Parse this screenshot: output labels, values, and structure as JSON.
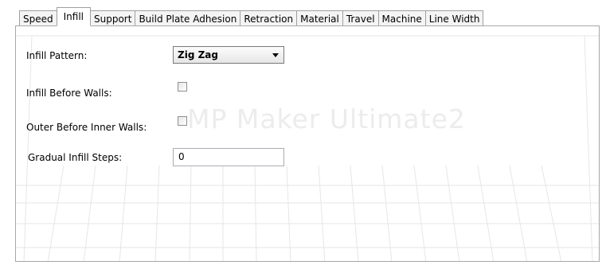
{
  "tabs": [
    {
      "label": "Speed"
    },
    {
      "label": "Infill"
    },
    {
      "label": "Support"
    },
    {
      "label": "Build Plate Adhesion"
    },
    {
      "label": "Retraction"
    },
    {
      "label": "Material"
    },
    {
      "label": "Travel"
    },
    {
      "label": "Machine"
    },
    {
      "label": "Line Width"
    }
  ],
  "active_tab": "Infill",
  "watermark": "MP Maker Ultimate2",
  "settings": {
    "infill_pattern": {
      "label": "Infill Pattern:",
      "value": "Zig Zag"
    },
    "infill_before_walls": {
      "label": "Infill Before Walls:",
      "checked": false
    },
    "outer_before_inner_walls": {
      "label": "Outer Before Inner Walls:",
      "checked": false
    },
    "gradual_infill_steps": {
      "label": "Gradual Infill Steps:",
      "value": "0"
    }
  }
}
